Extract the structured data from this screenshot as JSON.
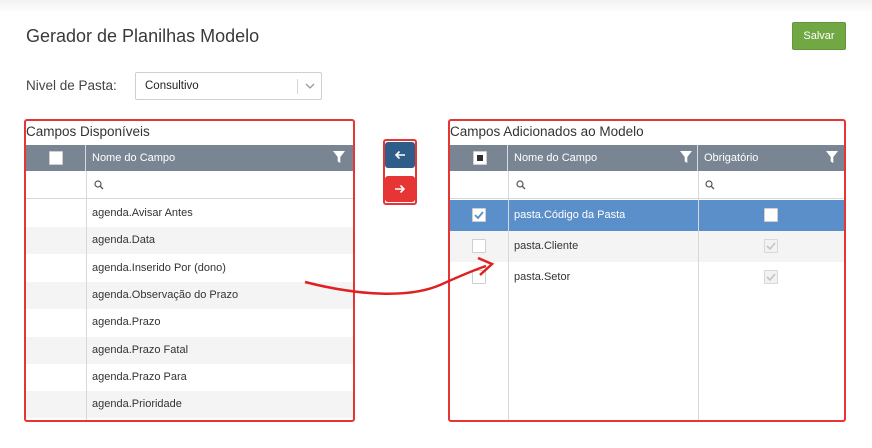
{
  "header": {
    "title": "Gerador de Planilhas Modelo",
    "save_label": "Salvar"
  },
  "level": {
    "label": "Nivel de Pasta:",
    "value": "Consultivo"
  },
  "available": {
    "title": "Campos Disponíveis",
    "column": "Nome do Campo",
    "rows": [
      "agenda.Avisar Antes",
      "agenda.Data",
      "agenda.Inserido Por (dono)",
      "agenda.Observação do Prazo",
      "agenda.Prazo",
      "agenda.Prazo Fatal",
      "agenda.Prazo Para",
      "agenda.Prioridade"
    ]
  },
  "transfer": {
    "left_icon": "arrow-left-icon",
    "right_icon": "arrow-right-icon"
  },
  "added": {
    "title": "Campos Adicionados ao Modelo",
    "column_name": "Nome do Campo",
    "column_required": "Obrigatório",
    "rows": [
      {
        "name": "pasta.Código da Pasta",
        "selected": true,
        "required": false
      },
      {
        "name": "pasta.Cliente",
        "selected": false,
        "required": true
      },
      {
        "name": "pasta.Setor",
        "selected": false,
        "required": true
      }
    ]
  },
  "colors": {
    "accent_red": "#e53535",
    "header_gray": "#7a8593",
    "selected_blue": "#5b8fc9",
    "save_green": "#72a843",
    "left_btn": "#2f5d8a",
    "right_btn": "#e53535"
  }
}
